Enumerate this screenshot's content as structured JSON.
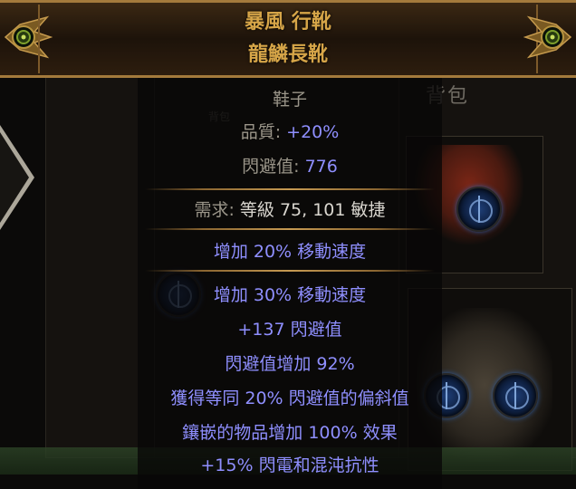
{
  "item": {
    "name": "暴風 行靴",
    "base": "龍鱗長靴",
    "type": "鞋子",
    "properties": [
      {
        "label": "品質",
        "value": "+20%"
      },
      {
        "label": "閃避值",
        "value": "776"
      }
    ],
    "requirements": {
      "prefix": "需求",
      "text": "等級 75, 101 敏捷"
    },
    "implicit": "增加 20% 移動速度",
    "explicit": [
      "增加 30% 移動速度",
      "+137 閃避值",
      "閃避值增加 92%",
      "獲得等同 20% 閃避值的偏斜值",
      "鑲嵌的物品增加 100% 效果",
      "+15% 閃電和混沌抗性"
    ]
  },
  "background": {
    "inventory_title": "背包",
    "small_label": "背包"
  },
  "colors": {
    "unique_name": "#d6a548",
    "property_label": "#9a9589",
    "property_value": "#8f8fff",
    "magic_mod": "#8f8fff",
    "separator": "#c69a52"
  }
}
